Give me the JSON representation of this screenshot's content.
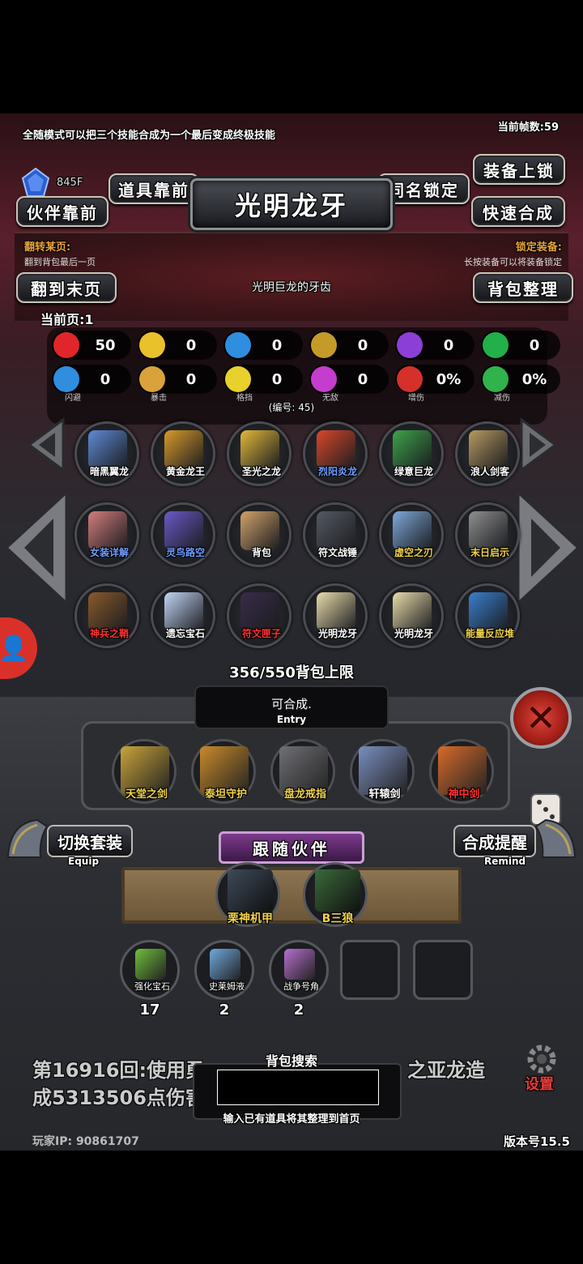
{
  "tip": "全随模式可以把三个技能合成为一个最后变成终极技能",
  "fps": "当前帧数:59",
  "gem_value": "845F",
  "buttons": {
    "lock_equip": "装备上锁",
    "item_front": "道具靠前",
    "same_lock": "同名锁定",
    "partner_front": "伙伴靠前",
    "quick_craft": "快速合成",
    "to_last_page": "翻到末页",
    "bag_sort": "背包整理"
  },
  "item_title": "光明龙牙",
  "item_desc": "光明巨龙的牙齿",
  "flip_title": "翻转某页:",
  "flip_sub": "翻到背包最后一页",
  "lock_title": "锁定装备:",
  "lock_sub": "长按装备可以将装备锁定",
  "current_page": "当前页:1",
  "stats": [
    {
      "icon": "heart-icon",
      "value": "50",
      "caption": "",
      "color": "#e0262b"
    },
    {
      "icon": "strength-icon",
      "value": "0",
      "caption": "",
      "color": "#e9c12b"
    },
    {
      "icon": "armor-icon",
      "value": "0",
      "caption": "",
      "color": "#2f8ee0"
    },
    {
      "icon": "bow-icon",
      "value": "0",
      "caption": "",
      "color": "#c59a28"
    },
    {
      "icon": "lightning-icon",
      "value": "0",
      "caption": "",
      "color": "#8c3fd6"
    },
    {
      "icon": "clover-icon",
      "value": "0",
      "caption": "",
      "color": "#22b04a"
    },
    {
      "icon": "dodge-icon",
      "value": "0",
      "caption": "闪避",
      "color": "#2f8ee0"
    },
    {
      "icon": "crit-icon",
      "value": "0",
      "caption": "暴击",
      "color": "#d9a23a"
    },
    {
      "icon": "block-icon",
      "value": "0",
      "caption": "格挡",
      "color": "#e8d12c"
    },
    {
      "icon": "invincible-icon",
      "value": "0",
      "caption": "无敌",
      "color": "#c53dcf"
    },
    {
      "icon": "damage-up-icon",
      "value": "0%",
      "caption": "增伤",
      "color": "#d6302b"
    },
    {
      "icon": "damage-down-icon",
      "value": "0%",
      "caption": "减伤",
      "color": "#2fb34a"
    }
  ],
  "code": "(编号: 45)",
  "bag_items": [
    {
      "name": "暗黑翼龙",
      "color": "#ffffff",
      "swatch": "#5f8bd6"
    },
    {
      "name": "黄金龙王",
      "color": "#ffffff",
      "swatch": "#d99b2a"
    },
    {
      "name": "圣光之龙",
      "color": "#ffffff",
      "swatch": "#e2b93a"
    },
    {
      "name": "烈阳炎龙",
      "color": "#6f9cff",
      "swatch": "#d8482a"
    },
    {
      "name": "绿意巨龙",
      "color": "#ffffff",
      "swatch": "#3ea34a"
    },
    {
      "name": "浪人剑客",
      "color": "#ffffff",
      "swatch": "#b79a62"
    },
    {
      "name": "女装详解",
      "color": "#6f9cff",
      "swatch": "#d57d7d"
    },
    {
      "name": "灵鸟路空",
      "color": "#6f9cff",
      "swatch": "#6a59c7"
    },
    {
      "name": "背包",
      "color": "#ffffff",
      "swatch": "#d2a36a"
    },
    {
      "name": "符文战锤",
      "color": "#ffffff",
      "swatch": "#555a63"
    },
    {
      "name": "虚空之刃",
      "color": "#f0d24a",
      "swatch": "#7fa9d9"
    },
    {
      "name": "末日启示",
      "color": "#f0d24a",
      "swatch": "#8f8f8f"
    },
    {
      "name": "神兵之鞘",
      "color": "#ff3030",
      "swatch": "#8a5a2a"
    },
    {
      "name": "遗忘宝石",
      "color": "#ffffff",
      "swatch": "#c3d6f5"
    },
    {
      "name": "符文匣子",
      "color": "#ff3030",
      "swatch": "#3a2c4a"
    },
    {
      "name": "光明龙牙",
      "color": "#ffffff",
      "swatch": "#e9dcaa"
    },
    {
      "name": "光明龙牙",
      "color": "#ffffff",
      "swatch": "#e9dcaa"
    },
    {
      "name": "能量反应堆",
      "color": "#f0d24a",
      "swatch": "#3a7fcf"
    }
  ],
  "bag_capacity": "356/550背包上限",
  "entry_text": "可合成.",
  "entry_sub": "Entry",
  "equipped": [
    {
      "name": "天堂之剑",
      "color": "#f0d24a",
      "swatch": "#c9a43a"
    },
    {
      "name": "泰坦守护",
      "color": "#f0d24a",
      "swatch": "#c98a2a"
    },
    {
      "name": "盘龙戒指",
      "color": "#f0d24a",
      "swatch": "#6f6f75"
    },
    {
      "name": "轩辕剑",
      "color": "#ffffff",
      "swatch": "#7a8ec0"
    },
    {
      "name": "神中剑",
      "color": "#ff3030",
      "swatch": "#d86a2a"
    }
  ],
  "switch_set": "切换套装",
  "switch_sub": "Equip",
  "craft_remind": "合成提醒",
  "craft_sub": "Remind",
  "follow_partner": "跟随伙伴",
  "partners": [
    {
      "name": "栗神机甲",
      "swatch": "#3d4a5a"
    },
    {
      "name": "B三狼",
      "swatch": "#3a6a3a"
    }
  ],
  "consumables": [
    {
      "name": "强化宝石",
      "count": "17",
      "swatch": "#6fc03a"
    },
    {
      "name": "史莱姆液",
      "count": "2",
      "swatch": "#6fa9e0"
    },
    {
      "name": "战争号角",
      "count": "2",
      "swatch": "#b86fd0"
    }
  ],
  "battle_log": "第16916回:使用勇 之亚龙造 成5313506点伤害",
  "battle_log_line1a": "第16916回:使用勇",
  "battle_log_line1b": "之亚龙造",
  "battle_log_line2": "成5313506点伤害",
  "search_label": "背包搜索",
  "search_value": "",
  "search_tip": "输入已有道具将其整理到首页",
  "player_ip": "玩家IP: 90861707",
  "version": "版本号15.5",
  "settings": "设置"
}
